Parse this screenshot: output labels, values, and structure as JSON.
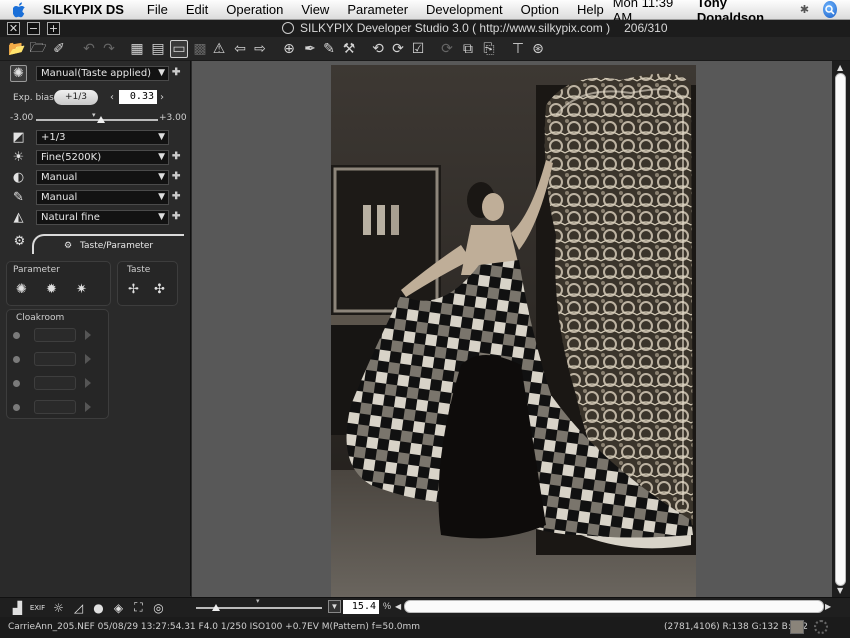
{
  "menubar": {
    "app_name": "SILKYPIX DS",
    "items": [
      "File",
      "Edit",
      "Operation",
      "View",
      "Parameter",
      "Development",
      "Option",
      "Help"
    ],
    "clock": "Mon 11:39 AM",
    "user": "Tony Donaldson"
  },
  "window": {
    "title": "SILKYPIX Developer Studio 3.0 ( http://www.silkypix.com )",
    "counter": "206/310",
    "buttons": [
      "✕",
      "−",
      "+"
    ]
  },
  "left_panel": {
    "taste_select": "Manual(Taste applied)",
    "exp_bias_label": "Exp. bias",
    "exp_bias_step": "+1/3",
    "exp_bias_value": "0.33",
    "exp_min": "-3.00",
    "exp_max": "+3.00",
    "exposure_select": "+1/3",
    "white_balance_select": "Fine(5200K)",
    "tone_select": "Manual",
    "sharpness_select": "Manual",
    "noise_select": "Natural fine",
    "tab_label": "Taste/Parameter",
    "parameter_group_label": "Parameter",
    "taste_group_label": "Taste",
    "cloakroom_label": "Cloakroom"
  },
  "viewer": {
    "zoom_value": "15.4",
    "zoom_unit": "%"
  },
  "status": {
    "info": "CarrieAnn_205.NEF 05/08/29 13:27:54.31 F4.0 1/250 ISO100 +0.7EV M(Pattern) f=50.0mm",
    "pixel": "(2781,4106) R:138 G:132 B:122"
  },
  "colors": {
    "swatch": "#8a847a",
    "panel_bg": "#2a2a2a",
    "viewer_bg": "#585858"
  }
}
